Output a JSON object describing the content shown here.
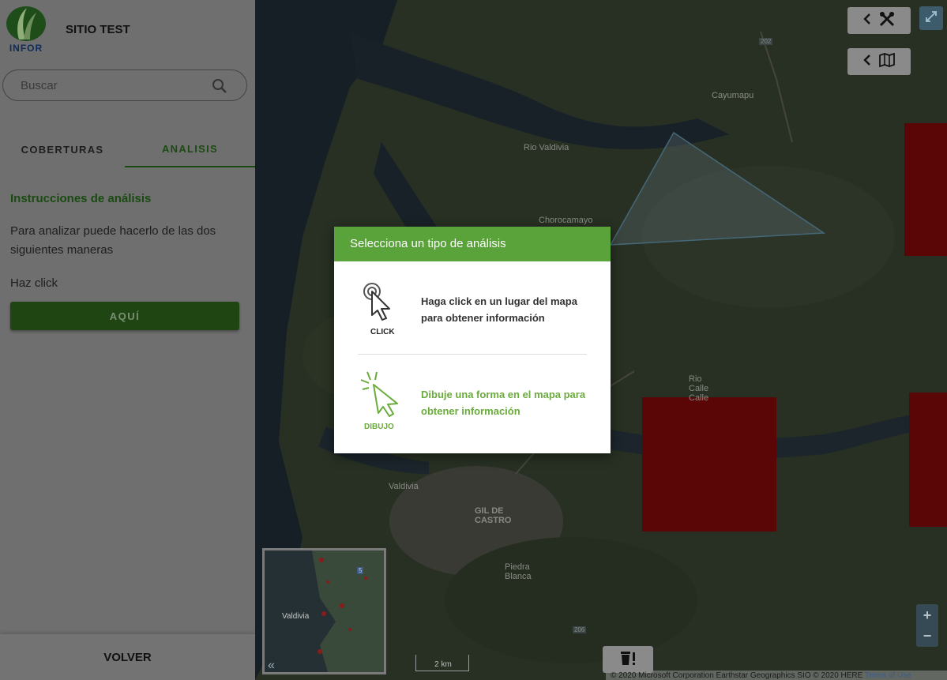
{
  "app": {
    "logo_text": "INFOR",
    "site_title": "SITIO TEST"
  },
  "search": {
    "placeholder": "Buscar"
  },
  "tabs": [
    {
      "label": "COBERTURAS",
      "active": false
    },
    {
      "label": "ANALISIS",
      "active": true
    }
  ],
  "analysis_panel": {
    "title": "Instrucciones de análisis",
    "description": "Para analizar puede hacerlo de las dos siguientes maneras",
    "click_label": "Haz click",
    "button_label": "AQUÍ"
  },
  "footer": {
    "back_label": "VOLVER"
  },
  "map": {
    "labels": [
      "Cayumapu",
      "Rio Valdivia",
      "Chorocamayo",
      "Rio Calle Calle",
      "Valdivia",
      "GIL DE CASTRO",
      "Piedra Blanca",
      "202",
      "206",
      "5"
    ],
    "overview_label": "Valdivia",
    "scale_label": "2 km",
    "attribution": "© 2020 Microsoft Corporation Earthstar Geographics SIO © 2020 HERE",
    "terms_label": "Terms of Use",
    "zoom_in": "+",
    "zoom_out": "−",
    "collapse_label": "«"
  },
  "modal": {
    "title": "Selecciona un tipo de análisis",
    "options": [
      {
        "icon_label": "CLICK",
        "text": "Haga click en un lugar del mapa para obtener información"
      },
      {
        "icon_label": "DIBUJO",
        "text": "Dibuje una forma en el mapa para obtener información"
      }
    ]
  },
  "colors": {
    "brand_green": "#5aa23a",
    "dark_green": "#1e4512",
    "polygon_red": "#8b0a0a"
  },
  "icons": [
    "tree-logo-icon",
    "search-icon",
    "chevron-left-icon",
    "tools-icon",
    "map-icon",
    "fullscreen-icon",
    "trash-alert-icon",
    "cursor-click-icon",
    "cursor-draw-icon"
  ]
}
